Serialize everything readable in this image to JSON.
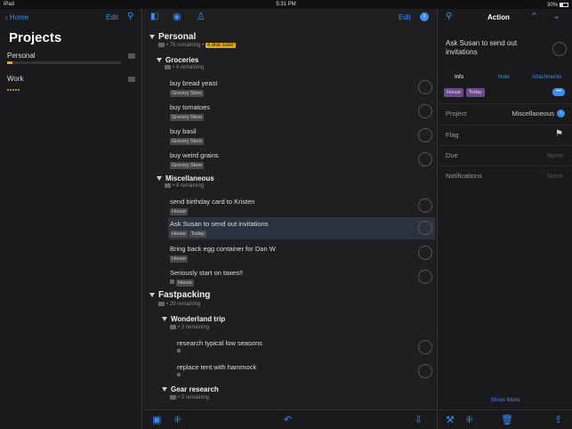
{
  "status": {
    "device": "iPad",
    "time": "5:31 PM",
    "battery": "30%"
  },
  "left": {
    "back_label": "Home",
    "edit_label": "Edit",
    "title": "Projects",
    "projects": [
      {
        "name": "Personal",
        "progress": 0.05
      },
      {
        "name": "Work",
        "progress": 0.0
      }
    ]
  },
  "mid": {
    "edit_label": "Edit",
    "sections": {
      "personal": {
        "title": "Personal",
        "remaining": "79 remaining",
        "due": "4 due soon"
      },
      "groceries": {
        "title": "Groceries",
        "remaining": "4 remaining"
      },
      "misc": {
        "title": "Miscellaneous",
        "remaining": "4 remaining"
      },
      "fastpacking": {
        "title": "Fastpacking",
        "remaining": "29 remaining"
      },
      "wonderland": {
        "title": "Wonderland trip",
        "remaining": "3 remaining"
      },
      "gear": {
        "title": "Gear research",
        "remaining": "3 remaining"
      }
    },
    "tasks": {
      "t1": {
        "title": "buy bread yeast",
        "tag": "Grocery Store"
      },
      "t2": {
        "title": "buy tomatoes",
        "tag": "Grocery Store"
      },
      "t3": {
        "title": "buy basil",
        "tag": "Grocery Store"
      },
      "t4": {
        "title": "buy weird grains",
        "tag": "Grocery Store"
      },
      "t5": {
        "title": "send birthday card to Kristen",
        "tag": "House"
      },
      "t6": {
        "title": "Ask Susan to send out invitations",
        "tag": "House",
        "tag2": "Today"
      },
      "t7": {
        "title": "Bring back egg container for Dan W",
        "tag": "House"
      },
      "t8": {
        "title": "Seriously start on taxes!!",
        "tag": "House"
      },
      "t9": {
        "title": "research typical low seasons"
      },
      "t10": {
        "title": "replace tent with hammock"
      }
    }
  },
  "right": {
    "header": "Action",
    "task_title": "Ask Susan to send out invitations",
    "tabs": {
      "info": "Info",
      "note": "Note",
      "attachments": "Attachments"
    },
    "tags": [
      "House",
      "Today"
    ],
    "fields": {
      "project": {
        "label": "Project",
        "value": "Miscellaneous"
      },
      "flag": {
        "label": "Flag"
      },
      "due": {
        "label": "Due",
        "value": "None"
      },
      "notifications": {
        "label": "Notifications",
        "value": "None"
      }
    },
    "show_more": "Show More"
  }
}
